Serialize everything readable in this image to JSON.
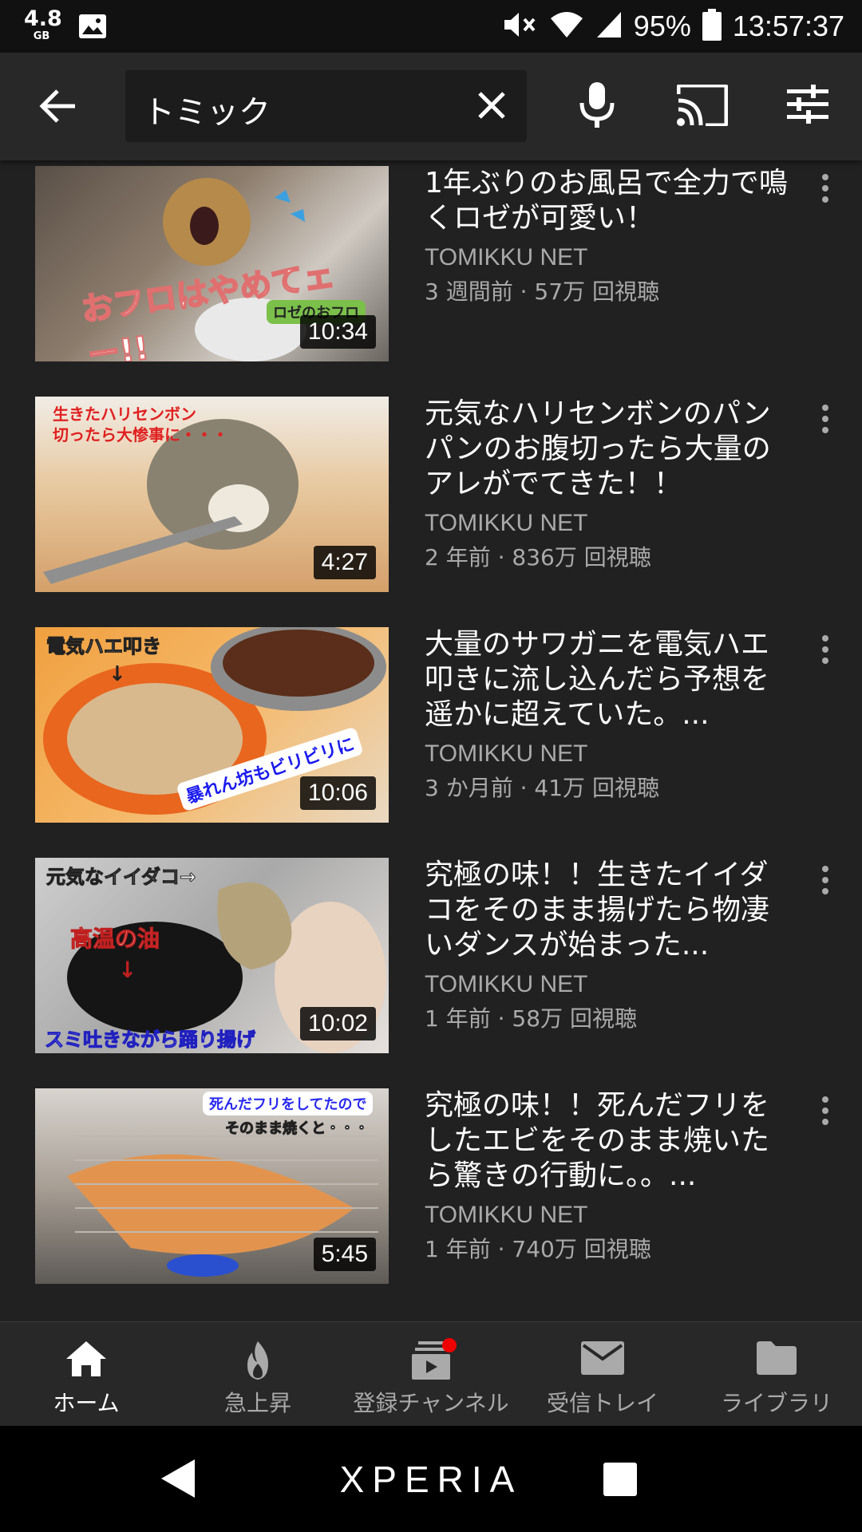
{
  "status_bar": {
    "memory_value": "4.8",
    "memory_unit": "GB",
    "battery": "95%",
    "time": "13:57:37",
    "icons": [
      "image-icon",
      "mute-icon",
      "wifi-icon",
      "signal-icon",
      "battery-icon"
    ]
  },
  "header": {
    "search_query": "トミック",
    "icons": [
      "back-arrow-icon",
      "clear-icon",
      "mic-icon",
      "cast-icon",
      "filter-icon"
    ]
  },
  "videos": [
    {
      "title": "1年ぶりのお風呂で全力で鳴くロゼが可愛い！",
      "channel": "TOMIKKU NET",
      "meta": "3 週間前 · 57万 回視聴",
      "duration": "10:34",
      "thumb_captions": [
        "おフロはやめてェー!!",
        "ロゼのおフロ"
      ]
    },
    {
      "title": "元気なハリセンボンのパンパンのお腹切ったら大量のアレがでてきた！！",
      "channel": "TOMIKKU NET",
      "meta": "2 年前 · 836万 回視聴",
      "duration": "4:27",
      "thumb_captions": [
        "生きたハリセンボン",
        "切ったら大惨事に・・・"
      ]
    },
    {
      "title": "大量のサワガニを電気ハエ叩きに流し込んだら予想を遥かに超えていた。...",
      "channel": "TOMIKKU NET",
      "meta": "3 か月前 · 41万 回視聴",
      "duration": "10:06",
      "thumb_captions": [
        "電気ハエ叩き",
        "↓",
        "暴れん坊もビリビリに"
      ]
    },
    {
      "title": "究極の味！！生きたイイダコをそのまま揚げたら物凄いダンスが始まった...",
      "channel": "TOMIKKU NET",
      "meta": "1 年前 · 58万 回視聴",
      "duration": "10:02",
      "thumb_captions": [
        "元気なイイダコ→",
        "高温の油",
        "↓",
        "スミ吐きながら踊り揚げ"
      ]
    },
    {
      "title": "究極の味！！死んだフリをしたエビをそのまま焼いたら驚きの行動に。。...",
      "channel": "TOMIKKU NET",
      "meta": "1 年前 · 740万 回視聴",
      "duration": "5:45",
      "thumb_captions": [
        "死んだフリをしてたので",
        "そのまま焼くと・・・"
      ]
    }
  ],
  "bottom_nav": [
    {
      "label": "ホーム",
      "icon": "home-icon",
      "active": true
    },
    {
      "label": "急上昇",
      "icon": "trending-fire-icon",
      "active": false
    },
    {
      "label": "登録チャンネル",
      "icon": "subscriptions-icon",
      "active": false
    },
    {
      "label": "受信トレイ",
      "icon": "inbox-mail-icon",
      "active": false
    },
    {
      "label": "ライブラリ",
      "icon": "library-folder-icon",
      "active": false
    }
  ],
  "system_nav": {
    "brand": "XPERIA",
    "icons": [
      "back-triangle-icon",
      "recents-square-icon"
    ]
  },
  "colors": {
    "background": "#212121",
    "header": "#282828",
    "secondary_text": "#aaaaaa",
    "notification_dot": "#ee0000"
  }
}
